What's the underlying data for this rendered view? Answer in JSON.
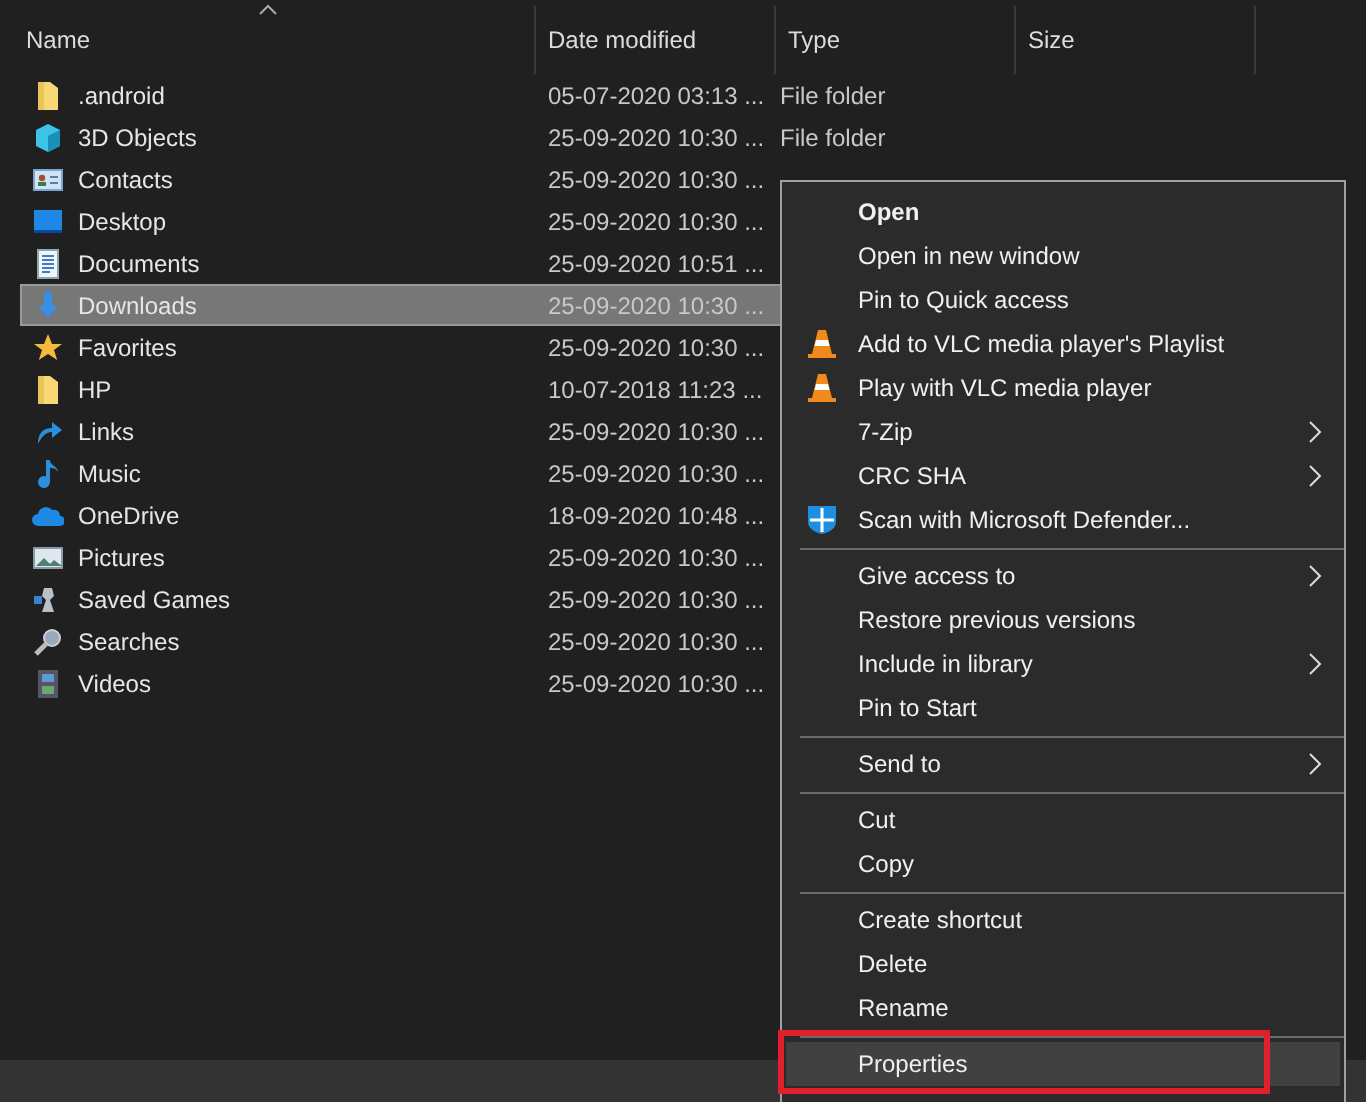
{
  "columns": [
    {
      "label": "Name",
      "sorted": true
    },
    {
      "label": "Date modified",
      "sorted": false
    },
    {
      "label": "Type",
      "sorted": false
    },
    {
      "label": "Size",
      "sorted": false
    }
  ],
  "files": [
    {
      "name": ".android",
      "kind": "folder",
      "date": "05-07-2020 03:13 ...",
      "type": "File folder",
      "selected": false
    },
    {
      "name": "3D Objects",
      "kind": "objects",
      "date": "25-09-2020 10:30 ...",
      "type": "File folder",
      "selected": false
    },
    {
      "name": "Contacts",
      "kind": "contacts",
      "date": "25-09-2020 10:30 ...",
      "selected": false
    },
    {
      "name": "Desktop",
      "kind": "desktop",
      "date": "25-09-2020 10:30 ...",
      "selected": false
    },
    {
      "name": "Documents",
      "kind": "documents",
      "date": "25-09-2020 10:51 ...",
      "selected": false
    },
    {
      "name": "Downloads",
      "kind": "downloads",
      "date": "25-09-2020 10:30 ...",
      "selected": true
    },
    {
      "name": "Favorites",
      "kind": "favorites",
      "date": "25-09-2020 10:30 ...",
      "selected": false
    },
    {
      "name": "HP",
      "kind": "folder",
      "date": "10-07-2018 11:23 ...",
      "selected": false
    },
    {
      "name": "Links",
      "kind": "links",
      "date": "25-09-2020 10:30 ...",
      "selected": false
    },
    {
      "name": "Music",
      "kind": "music",
      "date": "25-09-2020 10:30 ...",
      "selected": false
    },
    {
      "name": "OneDrive",
      "kind": "onedrive",
      "date": "18-09-2020 10:48 ...",
      "selected": false
    },
    {
      "name": "Pictures",
      "kind": "pictures",
      "date": "25-09-2020 10:30 ...",
      "selected": false
    },
    {
      "name": "Saved Games",
      "kind": "games",
      "date": "25-09-2020 10:30 ...",
      "selected": false
    },
    {
      "name": "Searches",
      "kind": "searches",
      "date": "25-09-2020 10:30 ...",
      "selected": false
    },
    {
      "name": "Videos",
      "kind": "videos",
      "date": "25-09-2020 10:30 ...",
      "selected": false
    }
  ],
  "context_menu": [
    {
      "kind": "item",
      "label": "Open",
      "default": true,
      "submenu": false,
      "selected": false
    },
    {
      "kind": "item",
      "label": "Open in new window",
      "default": false,
      "submenu": false,
      "selected": false
    },
    {
      "kind": "item",
      "label": "Pin to Quick access",
      "default": false,
      "submenu": false,
      "selected": false
    },
    {
      "kind": "vlc",
      "label": "Add to VLC media player's Playlist",
      "default": false,
      "submenu": false,
      "selected": false
    },
    {
      "kind": "vlc",
      "label": "Play with VLC media player",
      "default": false,
      "submenu": false,
      "selected": false
    },
    {
      "kind": "item",
      "label": "7-Zip",
      "default": false,
      "submenu": true,
      "selected": false
    },
    {
      "kind": "item",
      "label": "CRC SHA",
      "default": false,
      "submenu": true,
      "selected": false
    },
    {
      "kind": "shield",
      "label": "Scan with Microsoft Defender...",
      "default": false,
      "submenu": false,
      "selected": false
    },
    {
      "kind": "separator"
    },
    {
      "kind": "item",
      "label": "Give access to",
      "default": false,
      "submenu": true,
      "selected": false
    },
    {
      "kind": "item",
      "label": "Restore previous versions",
      "default": false,
      "submenu": false,
      "selected": false
    },
    {
      "kind": "item",
      "label": "Include in library",
      "default": false,
      "submenu": true,
      "selected": false
    },
    {
      "kind": "item",
      "label": "Pin to Start",
      "default": false,
      "submenu": false,
      "selected": false
    },
    {
      "kind": "separator"
    },
    {
      "kind": "item",
      "label": "Send to",
      "default": false,
      "submenu": true,
      "selected": false
    },
    {
      "kind": "separator"
    },
    {
      "kind": "item",
      "label": "Cut",
      "default": false,
      "submenu": false,
      "selected": false
    },
    {
      "kind": "item",
      "label": "Copy",
      "default": false,
      "submenu": false,
      "selected": false
    },
    {
      "kind": "separator"
    },
    {
      "kind": "item",
      "label": "Create shortcut",
      "default": false,
      "submenu": false,
      "selected": false
    },
    {
      "kind": "item",
      "label": "Delete",
      "default": false,
      "submenu": false,
      "selected": false
    },
    {
      "kind": "item",
      "label": "Rename",
      "default": false,
      "submenu": false,
      "selected": false
    },
    {
      "kind": "separator"
    },
    {
      "kind": "item",
      "label": "Properties",
      "default": false,
      "submenu": false,
      "selected": true,
      "highlighted": true
    }
  ]
}
